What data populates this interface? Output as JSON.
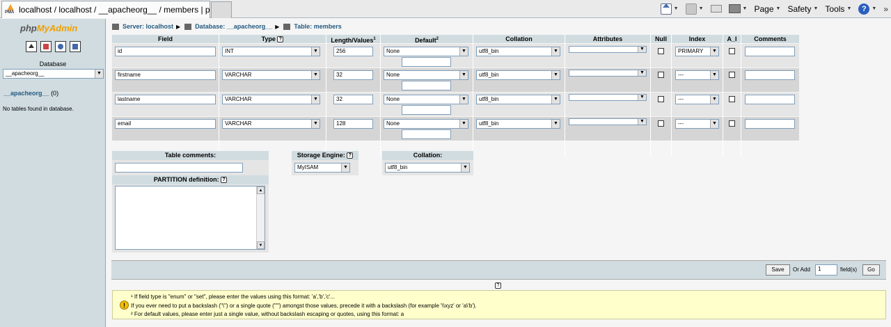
{
  "browser": {
    "tab_title": "localhost / localhost / __apacheorg__ / members | ph...",
    "tools": {
      "page": "Page",
      "safety": "Safety",
      "tools": "Tools",
      "help": "?",
      "chevrons": "»"
    }
  },
  "left": {
    "logo_php": "php",
    "logo_myadmin": "MyAdmin",
    "database_label": "Database",
    "database_select": "__apacheorg__",
    "db_link_name": "__apacheorg__",
    "db_link_count": "(0)",
    "no_tables": "No tables found in database."
  },
  "breadcrumb": {
    "server": "Server: localhost",
    "database": "Database: __apacheorg__",
    "table": "Table: members"
  },
  "table": {
    "headers": {
      "field": "Field",
      "type": "Type",
      "length": "Length/Values",
      "length_sup": "1",
      "default": "Default",
      "default_sup": "2",
      "collation": "Collation",
      "attributes": "Attributes",
      "null": "Null",
      "index": "Index",
      "ai": "A_I",
      "comments": "Comments"
    },
    "help_glyph": "?",
    "rows": [
      {
        "field": "id",
        "type": "INT",
        "length": "256",
        "default": "None",
        "collation": "utf8_bin",
        "index": "PRIMARY"
      },
      {
        "field": "firstname",
        "type": "VARCHAR",
        "length": "32",
        "default": "None",
        "collation": "utf8_bin",
        "index": "---"
      },
      {
        "field": "lastname",
        "type": "VARCHAR",
        "length": "32",
        "default": "None",
        "collation": "utf8_bin",
        "index": "---"
      },
      {
        "field": "email",
        "type": "VARCHAR",
        "length": "128",
        "default": "None",
        "collation": "utf8_bin",
        "index": "---"
      }
    ]
  },
  "options": {
    "table_comments": "Table comments:",
    "storage_engine_label": "Storage Engine:",
    "storage_engine_value": "MyISAM",
    "collation_label": "Collation:",
    "collation_value": "utf8_bin",
    "partition_label": "PARTITION definition:"
  },
  "actions": {
    "save": "Save",
    "or_add": "Or Add",
    "add_count": "1",
    "fields": "field(s)",
    "go": "Go"
  },
  "notes": [
    "¹ If field type is \"enum\" or \"set\", please enter the values using this format: 'a','b','c'...",
    "If you ever need to put a backslash (\"\\\") or a single quote (\"'\") amongst those values, precede it with a backslash (for example '\\\\xyz' or 'a\\'b').",
    "² For default values, please enter just a single value, without backslash escaping or quotes, using this format: a"
  ]
}
